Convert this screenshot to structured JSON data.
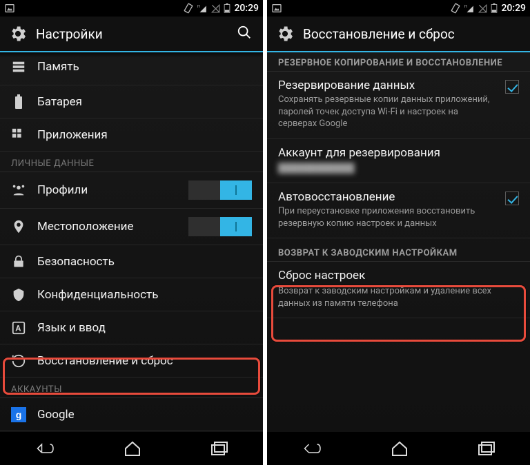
{
  "status": {
    "time": "20:29"
  },
  "left": {
    "title": "Настройки",
    "items": {
      "memory": "Память",
      "battery": "Батарея",
      "apps": "Приложения"
    },
    "section_personal": "ЛИЧНЫЕ ДАННЫЕ",
    "personal": {
      "profiles": "Профили",
      "location": "Местоположение",
      "security": "Безопасность",
      "privacy": "Конфиденциальность",
      "lang": "Язык и ввод",
      "backup_reset": "Восстановление и сброс"
    },
    "section_accounts": "АККАУНТЫ",
    "accounts": {
      "google": "Google"
    }
  },
  "right": {
    "title": "Восстановление и сброс",
    "section_backup": "РЕЗЕРВНОЕ КОПИРОВАНИЕ И ВОССТАНОВЛЕНИЕ",
    "backup_data_title": "Резервирование данных",
    "backup_data_sub": "Сохранять резервные копии данных приложений, паролей точек доступа Wi-Fi и настроек на серверах Google",
    "account_title": "Аккаунт для резервирования",
    "account_value": "████████████",
    "autorestore_title": "Автовосстановление",
    "autorestore_sub": "При переустановке приложения восстановить резервную копию настроек и данных",
    "section_factory": "ВОЗВРАТ К ЗАВОДСКИМ НАСТРОЙКАМ",
    "reset_title": "Сброс настроек",
    "reset_sub": "Возврат к заводским настройкам и удаление всех данных из памяти телефона"
  }
}
